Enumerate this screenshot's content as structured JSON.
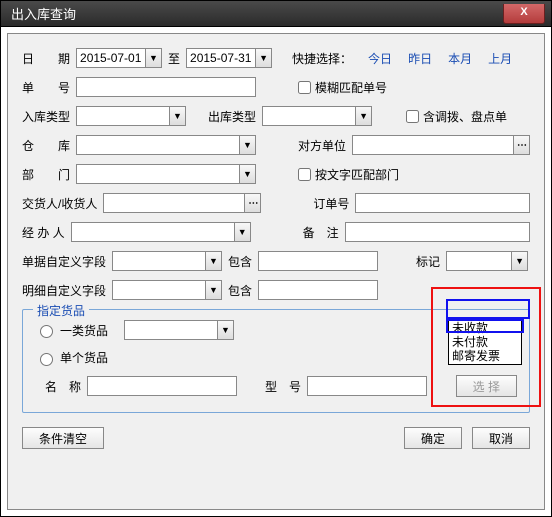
{
  "window": {
    "title": "出入库查询",
    "close": "X"
  },
  "labels": {
    "date": "日　　期",
    "to": "至",
    "quick": "快捷选择：",
    "today": "今日",
    "yesterday": "昨日",
    "thisMonth": "本月",
    "lastMonth": "上月",
    "orderNo": "单　　号",
    "fuzzyOrder": "模糊匹配单号",
    "inType": "入库类型",
    "outType": "出库类型",
    "includeTransfer": "含调拨、盘点单",
    "warehouse": "仓　　库",
    "counterparty": "对方单位",
    "dept": "部　　门",
    "deptMatch": "按文字匹配部门",
    "deliverer": "交货人/收货人",
    "subOrder": "订单号",
    "handler": "经 办 人",
    "remark": "备　注",
    "billCustom": "单据自定义字段",
    "contain": "包含",
    "mark": "标记",
    "detailCustom": "明细自定义字段",
    "fieldset": "指定货品",
    "catGoods": "一类货品",
    "singleGoods": "单个货品",
    "name": "名　称",
    "model": "型　号",
    "selectBtn": "选 择",
    "clear": "条件清空",
    "ok": "确定",
    "cancel": "取消"
  },
  "values": {
    "dateFrom": "2015-07-01",
    "dateTo": "2015-07-31",
    "orderNo": "",
    "inType": "",
    "outType": "",
    "warehouse": "",
    "counterparty": "",
    "dept": "",
    "deliverer": "",
    "subOrder": "",
    "handler": "",
    "remark": "",
    "billCustomField": "",
    "billCustomContain": "",
    "mark": "",
    "detailCustomField": "",
    "detailCustomContain": "",
    "catGoods": "",
    "name": "",
    "model": ""
  },
  "markOptions": [
    "未收款",
    "未付款",
    "邮寄发票"
  ]
}
